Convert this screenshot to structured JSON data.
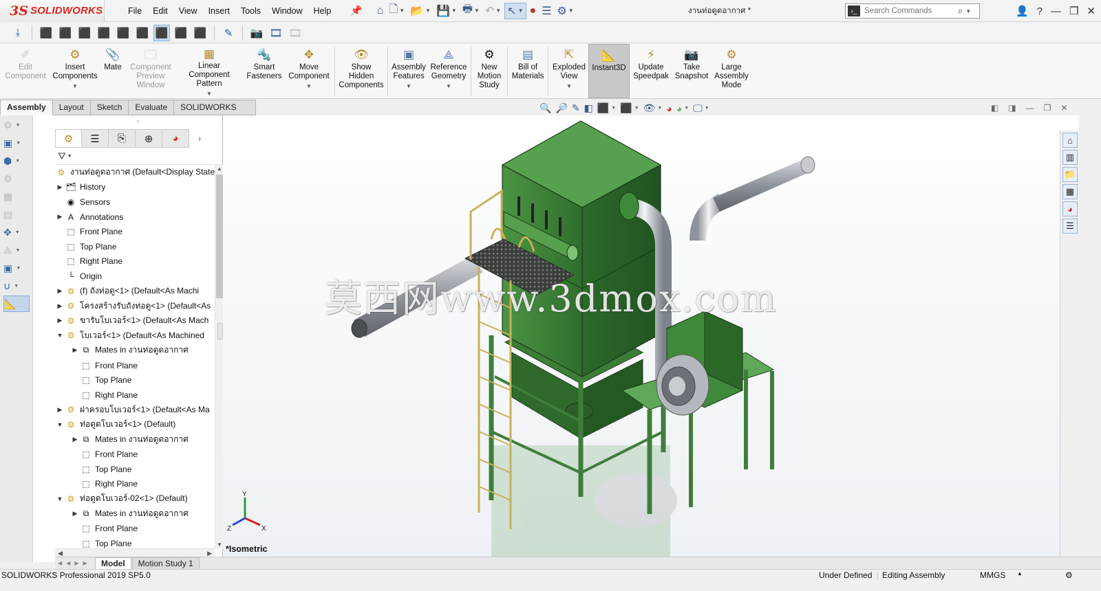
{
  "app": {
    "brand_ds": "3S",
    "brand": "SOLIDWORKS",
    "document_title": "งานท่อดูดอากาศ *"
  },
  "menu": [
    "File",
    "Edit",
    "View",
    "Insert",
    "Tools",
    "Window",
    "Help"
  ],
  "search": {
    "placeholder": "Search Commands"
  },
  "ribbon": {
    "commands": [
      {
        "label": "Edit Component",
        "icon": "edit-component-icon",
        "disabled": true
      },
      {
        "label": "Insert Components",
        "icon": "insert-components-icon"
      },
      {
        "label": "Mate",
        "icon": "mate-icon"
      },
      {
        "label": "Component Preview Window",
        "icon": "preview-window-icon",
        "disabled": true
      },
      {
        "label": "Linear Component Pattern",
        "icon": "linear-pattern-icon"
      },
      {
        "label": "Smart Fasteners",
        "icon": "smart-fasteners-icon"
      },
      {
        "label": "Move Component",
        "icon": "move-component-icon"
      },
      {
        "label": "Show Hidden Components",
        "icon": "show-hidden-icon"
      },
      {
        "label": "Assembly Features",
        "icon": "assembly-features-icon"
      },
      {
        "label": "Reference Geometry",
        "icon": "reference-geometry-icon"
      },
      {
        "label": "New Motion Study",
        "icon": "motion-study-icon"
      },
      {
        "label": "Bill of Materials",
        "icon": "bom-icon"
      },
      {
        "label": "Exploded View",
        "icon": "exploded-view-icon"
      },
      {
        "label": "Instant3D",
        "icon": "instant3d-icon",
        "active": true
      },
      {
        "label": "Update Speedpak",
        "icon": "speedpak-icon"
      },
      {
        "label": "Take Snapshot",
        "icon": "snapshot-icon"
      },
      {
        "label": "Large Assembly Mode",
        "icon": "large-assembly-icon"
      }
    ]
  },
  "tabs": {
    "assembly": "Assembly",
    "layout": "Layout",
    "sketch": "Sketch",
    "evaluate": "Evaluate",
    "addins": "SOLIDWORKS Add-Ins"
  },
  "tree": {
    "root": "งานท่อดูดอากาศ  (Default<Display State",
    "items": [
      {
        "label": "History"
      },
      {
        "label": "Sensors"
      },
      {
        "label": "Annotations"
      },
      {
        "label": "Front Plane"
      },
      {
        "label": "Top Plane"
      },
      {
        "label": "Right Plane"
      },
      {
        "label": "Origin"
      },
      {
        "label": "(f) ถังท่อดู<1> (Default<As Machi"
      },
      {
        "label": "โครงสร้างรับถังท่อดู<1> (Default<As"
      },
      {
        "label": "ขารับโบเวอร์<1> (Default<As Mach"
      },
      {
        "label": "โบเวอร์<1> (Default<As Machined"
      },
      {
        "label": "Mates in งานท่อดูดอากาศ"
      },
      {
        "label": "Front Plane"
      },
      {
        "label": "Top Plane"
      },
      {
        "label": "Right Plane"
      },
      {
        "label": "ฝาครอบโบเวอร์<1> (Default<As Ma"
      },
      {
        "label": "ท่อดูดโบเวอร์<1> (Default)"
      },
      {
        "label": "Mates in งานท่อดูดอากาศ"
      },
      {
        "label": "Front Plane"
      },
      {
        "label": "Top Plane"
      },
      {
        "label": "Right Plane"
      },
      {
        "label": "ท่อดูดโบเวอร์-02<1> (Default)"
      },
      {
        "label": "Mates in งานท่อดูดอากาศ"
      },
      {
        "label": "Front Plane"
      },
      {
        "label": "Top Plane"
      }
    ]
  },
  "viewport": {
    "view_label": "*Isometric",
    "watermark": "莫西网www.3dmox.com",
    "triad": {
      "x": "X",
      "y": "Y",
      "z": "Z"
    }
  },
  "bottom_tabs": {
    "model": "Model",
    "motion": "Motion Study 1"
  },
  "status": {
    "product": "SOLIDWORKS Professional 2019 SP5.0",
    "definition": "Under Defined",
    "mode": "Editing Assembly",
    "units": "MMGS"
  },
  "colors": {
    "accent": "#d9261c",
    "equipment": "#3f8a3a",
    "frame": "#4e8a4a",
    "rail": "#c8b15a",
    "duct": "#c0c4ca"
  }
}
